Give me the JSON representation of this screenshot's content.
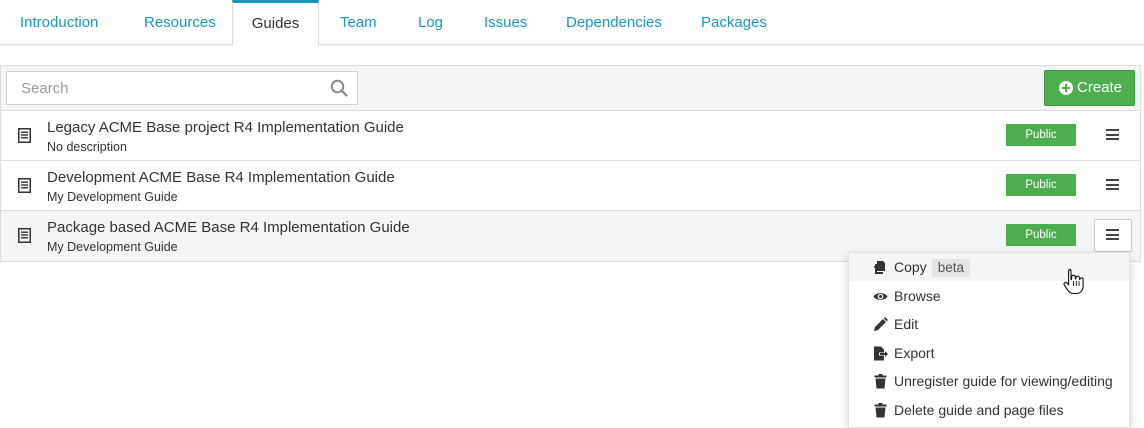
{
  "tabs": [
    {
      "label": "Introduction"
    },
    {
      "label": "Resources"
    },
    {
      "label": "Guides",
      "active": true
    },
    {
      "label": "Team"
    },
    {
      "label": "Log"
    },
    {
      "label": "Issues"
    },
    {
      "label": "Dependencies"
    },
    {
      "label": "Packages"
    }
  ],
  "toolbar": {
    "search_placeholder": "Search",
    "search_value": "",
    "create_label": "Create"
  },
  "guides": [
    {
      "title": "Legacy ACME Base project R4 Implementation Guide",
      "description": "No description",
      "badge": "Public"
    },
    {
      "title": "Development ACME Base R4 Implementation Guide",
      "description": "My Development Guide",
      "badge": "Public"
    },
    {
      "title": "Package based ACME Base R4 Implementation Guide",
      "description": "My Development Guide",
      "badge": "Public"
    }
  ],
  "menu": {
    "items": [
      {
        "label": "Copy",
        "tag": "beta",
        "icon": "copy-icon"
      },
      {
        "label": "Browse",
        "icon": "eye-icon"
      },
      {
        "label": "Edit",
        "icon": "pencil-icon"
      },
      {
        "label": "Export",
        "icon": "export-icon"
      },
      {
        "label": "Unregister guide for viewing/editing",
        "icon": "trash-icon"
      },
      {
        "label": "Delete guide and page files",
        "icon": "trash-icon"
      }
    ]
  },
  "colors": {
    "accent": "#1a98b8",
    "success": "#4cae4c",
    "border": "#dddddd"
  }
}
